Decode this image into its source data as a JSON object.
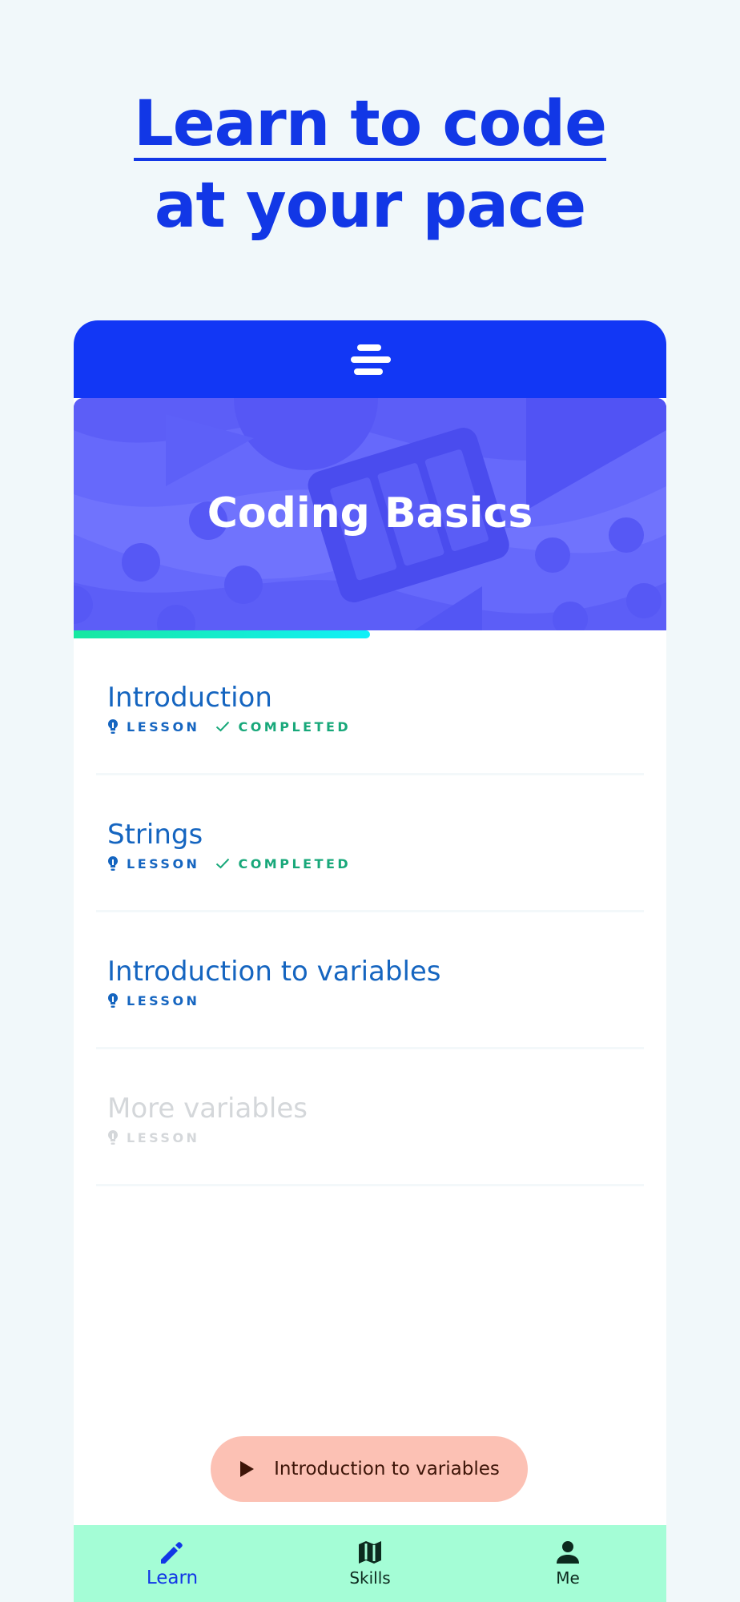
{
  "headline": {
    "line1": "Learn to code",
    "line2": "at your pace"
  },
  "app": {
    "course_title": "Coding Basics",
    "progress": 0.5,
    "colors": {
      "primary": "#1237f5",
      "hero": "#6669fb",
      "accent_progress": "#10f0f8",
      "nav_bg": "#a4fdd6",
      "cta_bg": "#fcc1b4"
    },
    "lessons": [
      {
        "title": "Introduction",
        "type": "LESSON",
        "status": "COMPLETED"
      },
      {
        "title": "Strings",
        "type": "LESSON",
        "status": "COMPLETED"
      },
      {
        "title": "Introduction to variables",
        "type": "LESSON",
        "status": ""
      },
      {
        "title": "More variables",
        "type": "LESSON",
        "status": ""
      }
    ],
    "cta": {
      "label": "Introduction to variables",
      "icon": "play-icon"
    },
    "nav": [
      {
        "label": "Learn",
        "icon": "pencil-icon"
      },
      {
        "label": "Skills",
        "icon": "map-icon"
      },
      {
        "label": "Me",
        "icon": "person-icon"
      }
    ]
  }
}
